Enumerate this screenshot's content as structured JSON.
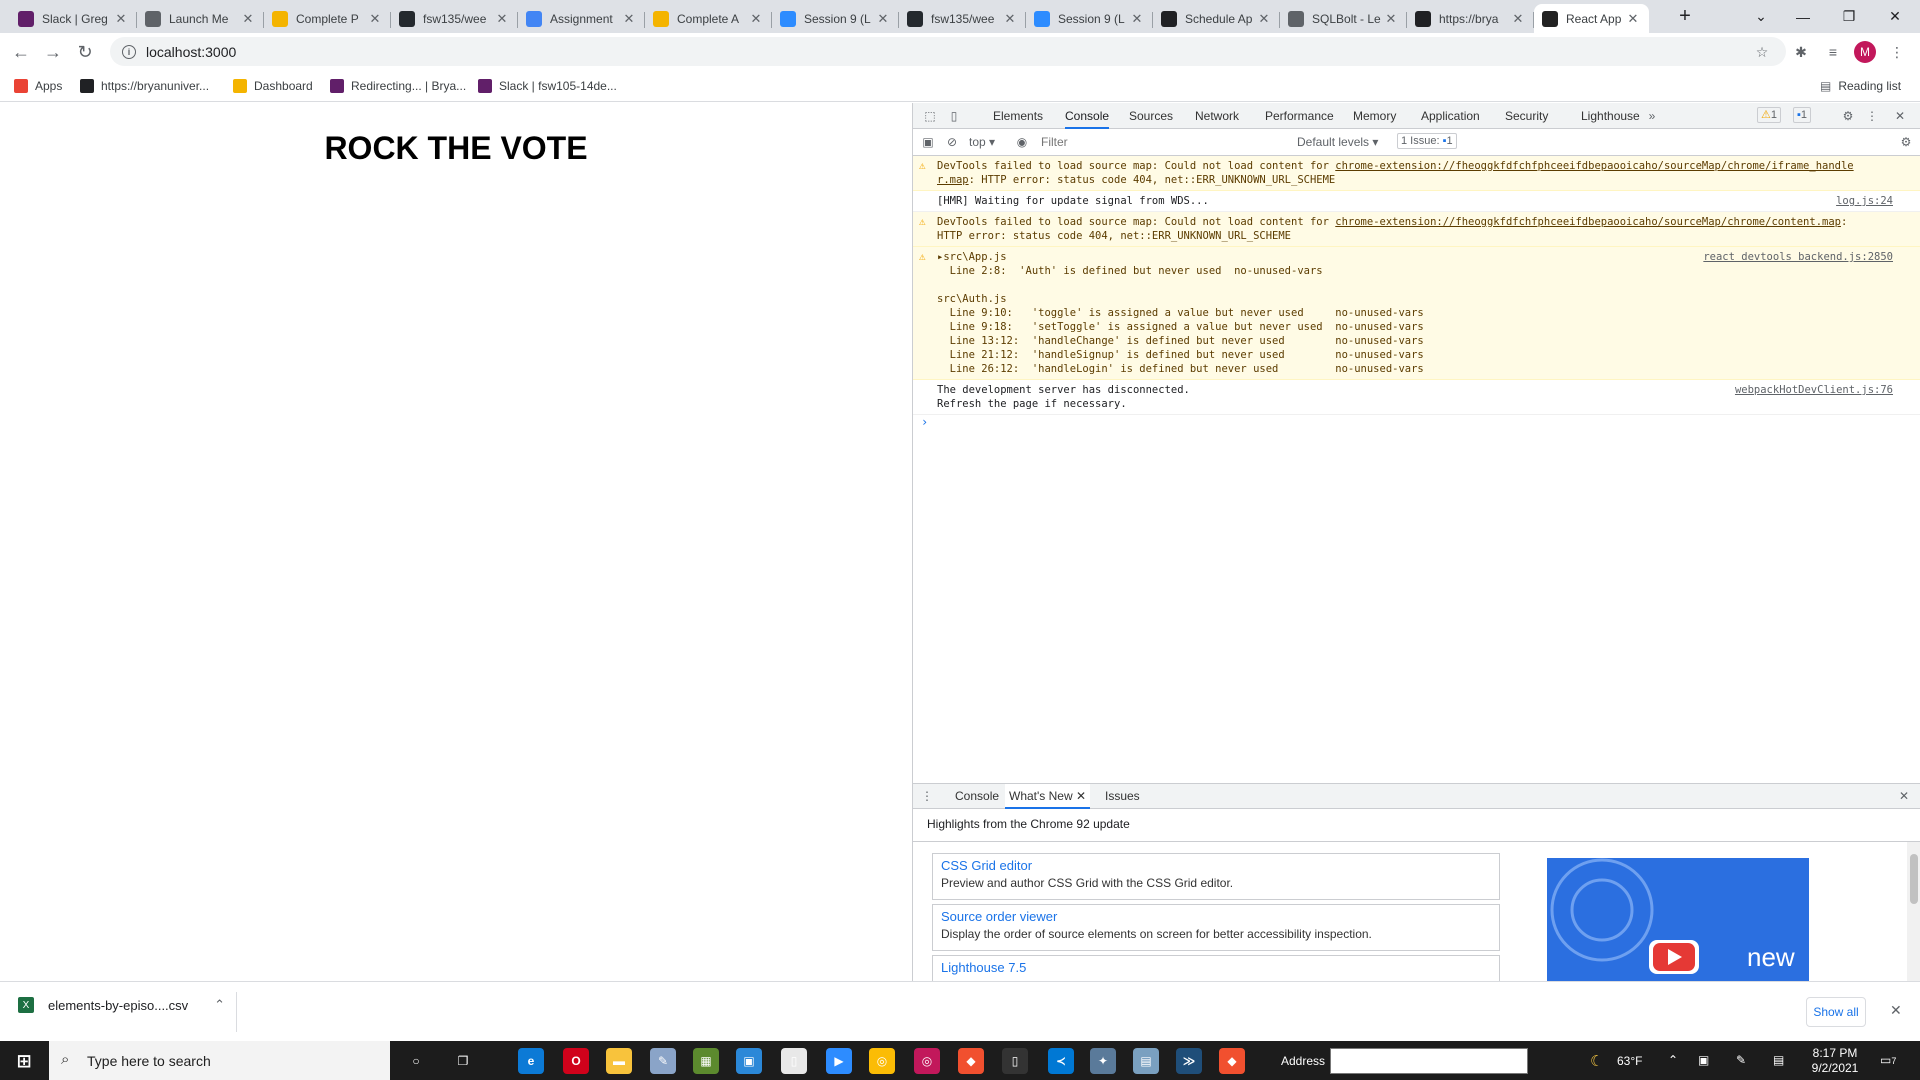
{
  "browser": {
    "tabs": [
      {
        "label": "Slack | Greg",
        "color": "#611f69"
      },
      {
        "label": "Launch Me",
        "color": "#5f6368"
      },
      {
        "label": "Complete P",
        "color": "#f4b400"
      },
      {
        "label": "fsw135/wee",
        "color": "#24292e"
      },
      {
        "label": "Assignment",
        "color": "#4285f4"
      },
      {
        "label": "Complete A",
        "color": "#f4b400"
      },
      {
        "label": "Session 9 (L",
        "color": "#2d8cff"
      },
      {
        "label": "fsw135/wee",
        "color": "#24292e"
      },
      {
        "label": "Session 9 (L",
        "color": "#2d8cff"
      },
      {
        "label": "Schedule Ap",
        "color": "#202124"
      },
      {
        "label": "SQLBolt - Le",
        "color": "#5f6368"
      },
      {
        "label": "https://brya",
        "color": "#202124"
      },
      {
        "label": "React App",
        "color": "#222222"
      }
    ],
    "new_tab": "+",
    "url": "localhost:3000",
    "avatar_letter": "M",
    "reading_list": "Reading list",
    "bookmarks": [
      {
        "label": "Apps",
        "color": "#ea4335"
      },
      {
        "label": "https://bryanuniver...",
        "color": "#202124"
      },
      {
        "label": "Dashboard",
        "color": "#f4b400"
      },
      {
        "label": "Redirecting... | Brya...",
        "color": "#611f69"
      },
      {
        "label": "Slack | fsw105-14de...",
        "color": "#611f69"
      }
    ]
  },
  "page": {
    "title": "ROCK THE VOTE"
  },
  "devtools": {
    "tabs": [
      "Elements",
      "Console",
      "Sources",
      "Network",
      "Performance",
      "Memory",
      "Application",
      "Security",
      "Lighthouse"
    ],
    "active_tab": "Console",
    "warn_count": "1",
    "msg_count": "1",
    "context": "top",
    "filter_placeholder": "Filter",
    "levels": "Default levels",
    "issues_label": "1 Issue:",
    "issues_count": "1",
    "messages": {
      "m1_text": "DevTools failed to load source map: Could not load content for ",
      "m1_link": "chrome-extension://fheoggkfdfchfphceeifdbepaooicaho/sourceMap/chrome/iframe_handle\nr.map",
      "m1_tail": ": HTTP error: status code 404, net::ERR_UNKNOWN_URL_SCHEME",
      "m2_text": "[HMR] Waiting for update signal from WDS...",
      "m2_src": "log.js:24",
      "m3_text": "DevTools failed to load source map: Could not load content for ",
      "m3_link": "chrome-extension://fheoggkfdfchfphceeifdbepaooicaho/sourceMap/chrome/content.map",
      "m3_tail": ":\nHTTP error: status code 404, net::ERR_UNKNOWN_URL_SCHEME",
      "m4_text": "▸src\\App.js\n  Line 2:8:  'Auth' is defined but never used  no-unused-vars\n\nsrc\\Auth.js\n  Line 9:10:   'toggle' is assigned a value but never used     no-unused-vars\n  Line 9:18:   'setToggle' is assigned a value but never used  no-unused-vars\n  Line 13:12:  'handleChange' is defined but never used        no-unused-vars\n  Line 21:12:  'handleSignup' is defined but never used        no-unused-vars\n  Line 26:12:  'handleLogin' is defined but never used         no-unused-vars",
      "m4_src": "react devtools backend.js:2850",
      "m5_text": "The development server has disconnected.\nRefresh the page if necessary.",
      "m5_src": "webpackHotDevClient.js:76"
    },
    "drawer": {
      "tabs": [
        "Console",
        "What's New",
        "Issues"
      ],
      "highlights": "Highlights from the Chrome 92 update",
      "items": [
        {
          "title": "CSS Grid editor",
          "desc": "Preview and author CSS Grid with the CSS Grid editor."
        },
        {
          "title": "Source order viewer",
          "desc": "Display the order of source elements on screen for better accessibility inspection."
        },
        {
          "title": "Lighthouse 7.5",
          "desc": ""
        }
      ],
      "video_label": "new"
    }
  },
  "downloads": {
    "file": "elements-by-episo....csv",
    "show_all": "Show all"
  },
  "taskbar": {
    "search_placeholder": "Type here to search",
    "address_label": "Address",
    "weather": "63°F",
    "time": "8:17 PM",
    "date": "9/2/2021",
    "notif_count": "7"
  }
}
